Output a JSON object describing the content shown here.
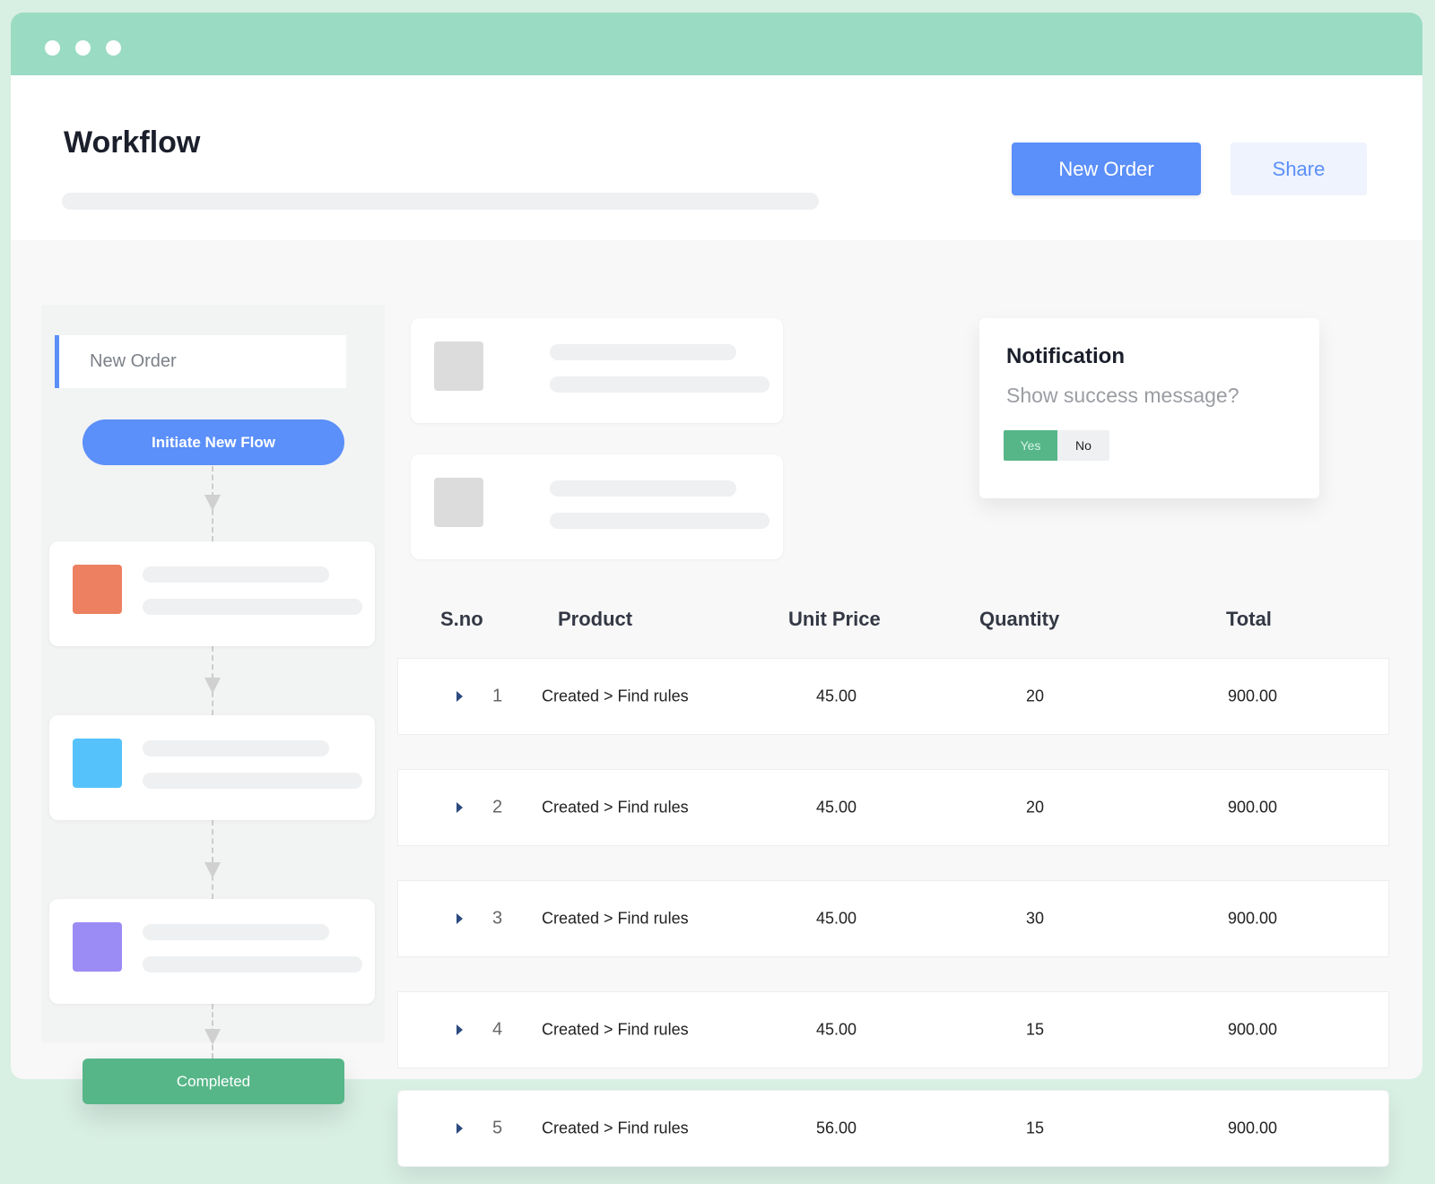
{
  "window": {
    "title": "Workflow",
    "colors": {
      "titlebar": "#9adbc3",
      "accent": "#5b8ff9",
      "success": "#56b688"
    }
  },
  "header": {
    "new_order_label": "New Order",
    "share_label": "Share"
  },
  "flow": {
    "input_value": "New Order",
    "initiate_label": "Initiate New Flow",
    "completed_label": "Completed",
    "steps": [
      {
        "color": "#ec8060"
      },
      {
        "color": "#56c2fb"
      },
      {
        "color": "#9b8bf4"
      }
    ]
  },
  "notification": {
    "title": "Notification",
    "message": "Show success message?",
    "yes_label": "Yes",
    "no_label": "No",
    "selected": "Yes"
  },
  "table": {
    "headers": [
      "S.no",
      "Product",
      "Unit Price",
      "Quantity",
      "Total"
    ],
    "rows": [
      {
        "sno": "1",
        "product": "Created > Find rules",
        "unit_price": "45.00",
        "quantity": "20",
        "total": "900.00"
      },
      {
        "sno": "2",
        "product": "Created > Find rules",
        "unit_price": "45.00",
        "quantity": "20",
        "total": "900.00"
      },
      {
        "sno": "3",
        "product": "Created > Find rules",
        "unit_price": "45.00",
        "quantity": "30",
        "total": "900.00"
      },
      {
        "sno": "4",
        "product": "Created > Find rules",
        "unit_price": "45.00",
        "quantity": "15",
        "total": "900.00"
      },
      {
        "sno": "5",
        "product": "Created > Find rules",
        "unit_price": "56.00",
        "quantity": "15",
        "total": "900.00"
      }
    ]
  }
}
